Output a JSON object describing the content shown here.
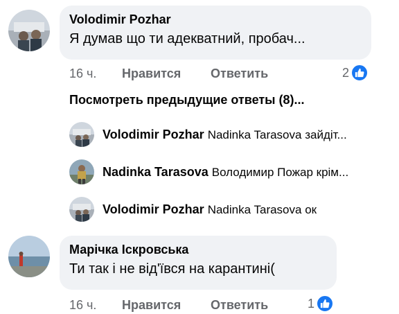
{
  "comments": [
    {
      "author": "Volodimir Pozhar",
      "text": "Я думав що ти адекватний, пробач...",
      "time": "16 ч.",
      "like_label": "Нравится",
      "reply_label": "Ответить",
      "reaction_count": "2"
    },
    {
      "author": "Марічка Іскровська",
      "text": "Ти так і не від'ївся на карантині(",
      "time": "16 ч.",
      "like_label": "Нравится",
      "reply_label": "Ответить",
      "reaction_count": "1"
    }
  ],
  "previous_replies_label": "Посмотреть предыдущие ответы (8)...",
  "replies": [
    {
      "author": "Volodimir Pozhar",
      "text": "Nadinka Tarasova зайдіт..."
    },
    {
      "author": "Nadinka Tarasova",
      "text": "Володимир Пожар крім..."
    },
    {
      "author": "Volodimir Pozhar",
      "text": "Nadinka Tarasova ок"
    }
  ],
  "colors": {
    "bubble": "#f0f2f5",
    "meta_text": "#65676b",
    "like_blue": "#1877f2"
  },
  "icons": [
    "like-reaction-icon"
  ]
}
